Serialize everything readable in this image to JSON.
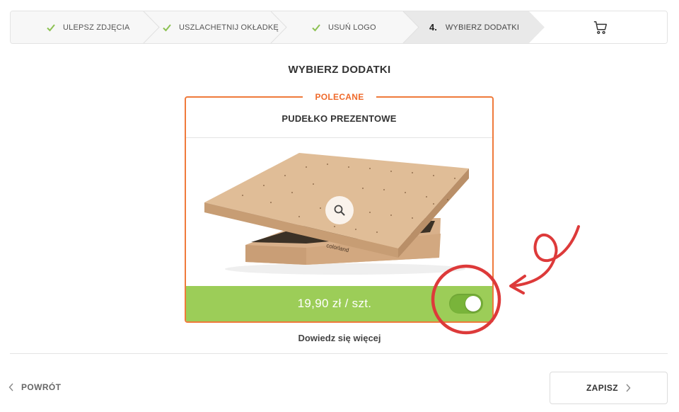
{
  "stepper": {
    "steps": [
      {
        "label": "ULEPSZ ZDJĘCIA",
        "done": true
      },
      {
        "label": "USZLACHETNIJ OKŁADKĘ",
        "done": true
      },
      {
        "label": "USUŃ LOGO",
        "done": true
      },
      {
        "number": "4.",
        "label": "WYBIERZ DODATKI",
        "active": true
      }
    ],
    "cart_icon": "cart-icon"
  },
  "page": {
    "title": "WYBIERZ DODATKI"
  },
  "addon": {
    "badge": "POLECANE",
    "title": "PUDEŁKO PREZENTOWE",
    "image_brand": "colorland",
    "price": "19,90 zł / szt.",
    "selected": true,
    "learn_more": "Dowiedz się więcej"
  },
  "footer": {
    "back_label": "POWRÓT",
    "save_label": "ZAPISZ"
  },
  "colors": {
    "accent_orange": "#ef7a3b",
    "price_green": "#9ccd58",
    "toggle_green": "#79b43a",
    "check_green": "#8cc152",
    "annotation_red": "#dd3a3a"
  }
}
